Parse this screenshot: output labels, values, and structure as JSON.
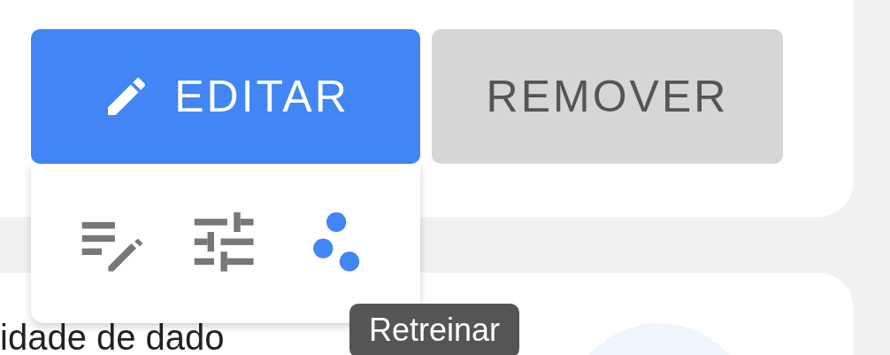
{
  "buttons": [
    {
      "label": "EDITAR",
      "kind": "primary"
    },
    {
      "label": "REMOVER",
      "kind": "secondary"
    }
  ],
  "menu": {
    "items": [
      {
        "kind": "edit-notes",
        "selected": false
      },
      {
        "kind": "tune",
        "selected": false
      },
      {
        "kind": "scatter",
        "selected": true
      }
    ]
  },
  "tooltip": "Retreinar",
  "body_text": "idade de dado"
}
